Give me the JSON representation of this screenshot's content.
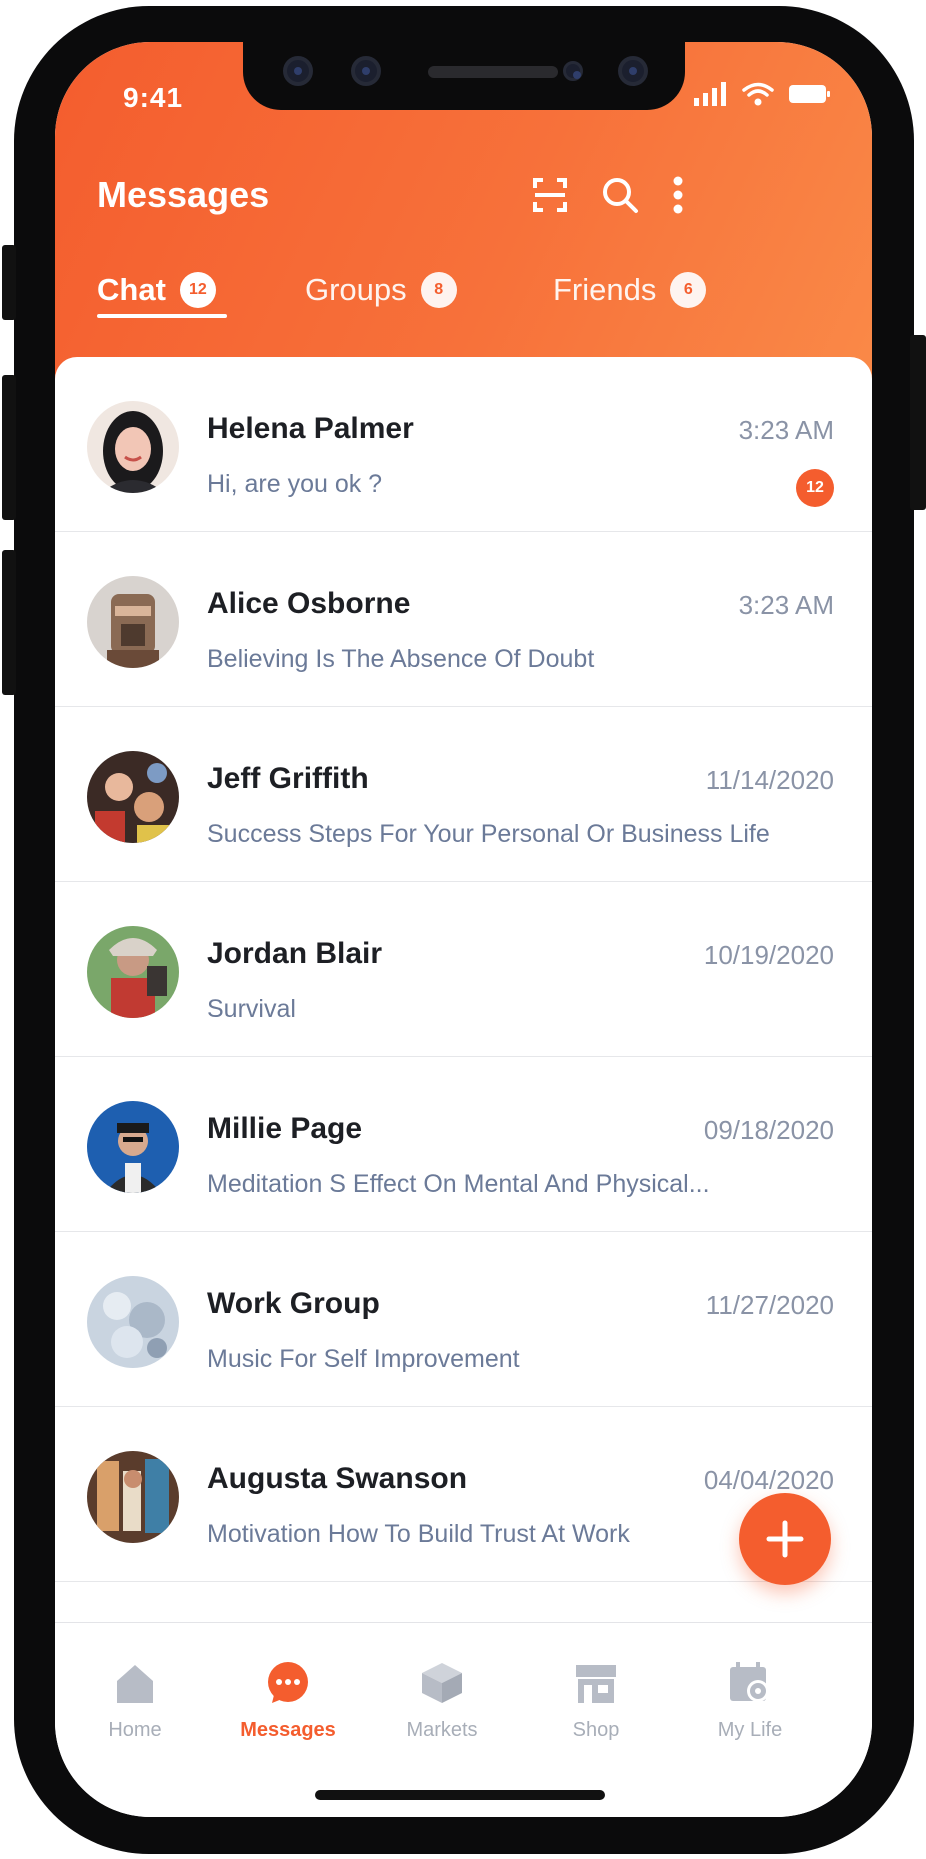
{
  "status_bar": {
    "time": "9:41"
  },
  "header": {
    "title": "Messages",
    "icons": [
      "scan-icon",
      "search-icon",
      "more-vertical-icon"
    ]
  },
  "tabs": [
    {
      "label": "Chat",
      "badge": "12",
      "active": true
    },
    {
      "label": "Groups",
      "badge": "8",
      "active": false
    },
    {
      "label": "Friends",
      "badge": "6",
      "active": false
    }
  ],
  "conversations": [
    {
      "name": "Helena Palmer",
      "time": "3:23 AM",
      "preview": "Hi, are you ok ?",
      "unread": "12"
    },
    {
      "name": "Alice Osborne",
      "time": "3:23 AM",
      "preview": "Believing Is The Absence Of Doubt"
    },
    {
      "name": "Jeff Griffith",
      "time": "11/14/2020",
      "preview": "Success Steps For Your Personal Or Business Life"
    },
    {
      "name": "Jordan Blair",
      "time": "10/19/2020",
      "preview": "Survival"
    },
    {
      "name": "Millie Page",
      "time": "09/18/2020",
      "preview": "Meditation S Effect On Mental And Physical..."
    },
    {
      "name": "Work Group",
      "time": "11/27/2020",
      "preview": "Music For Self Improvement"
    },
    {
      "name": "Augusta Swanson",
      "time": "04/04/2020",
      "preview": "Motivation How To Build Trust At Work"
    }
  ],
  "fab": {
    "icon": "plus-icon"
  },
  "bottom_nav": [
    {
      "label": "Home",
      "icon": "home-icon",
      "active": false
    },
    {
      "label": "Messages",
      "icon": "chat-bubble-icon",
      "active": true
    },
    {
      "label": "Markets",
      "icon": "box-icon",
      "active": false
    },
    {
      "label": "Shop",
      "icon": "store-icon",
      "active": false
    },
    {
      "label": "My Life",
      "icon": "calendar-icon",
      "active": false
    }
  ],
  "colors": {
    "accent": "#f45d2e",
    "name_text": "#1d1f24",
    "preview_text": "#6b7a98",
    "time_text": "#8a93a6"
  }
}
